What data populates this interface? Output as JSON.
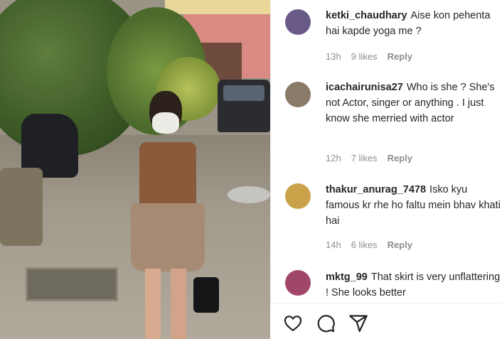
{
  "comments": [
    {
      "username": "ketki_chaudhary",
      "text": "Aise kon pehenta hai kapde yoga me ?",
      "time": "13h",
      "likes": "9 likes",
      "reply": "Reply",
      "avatar_color": "#6a5a8a"
    },
    {
      "username": "icachairunisa27",
      "text": "Who is she ? She's not Actor, singer or anything . I just know she merried with actor",
      "time": "12h",
      "likes": "7 likes",
      "reply": "Reply",
      "avatar_color": "#8a7a6a"
    },
    {
      "username": "thakur_anurag_7478",
      "text": "Isko kyu famous kr rhe ho faltu mein bhav khati hai",
      "time": "14h",
      "likes": "6 likes",
      "reply": "Reply",
      "avatar_color": "#c9a24a"
    },
    {
      "username": "mktg_99",
      "text": "That skirt is very unflattering ! She looks better",
      "avatar_color": "#a0466a"
    }
  ],
  "actions": {
    "like_icon": "heart-icon",
    "comment_icon": "comment-icon",
    "share_icon": "share-icon"
  }
}
